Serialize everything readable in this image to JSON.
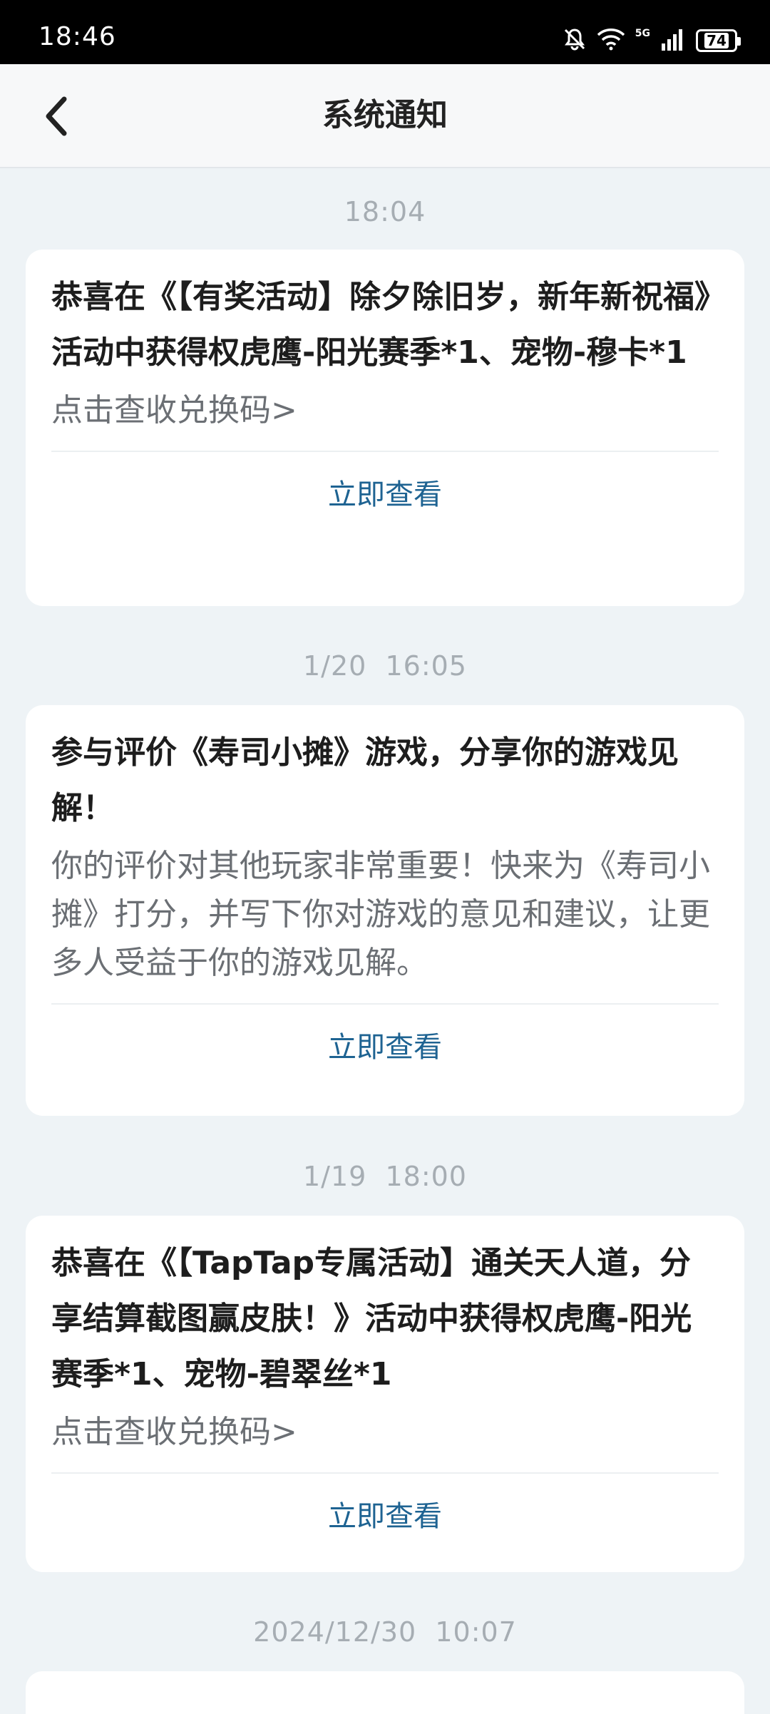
{
  "status_bar": {
    "time": "18:46",
    "network": "5G",
    "battery": "74"
  },
  "header": {
    "title": "系统通知"
  },
  "notifications": [
    {
      "timestamp": "18:04",
      "title": "恭喜在《【有奖活动】除夕除旧岁，新年新祝福》活动中获得权虎鹰-阳光赛季*1、宠物-穆卡*1",
      "body": "点击查收兑换码>",
      "action": "立即查看"
    },
    {
      "timestamp": "1/20  16:05",
      "title": "参与评价《寿司小摊》游戏，分享你的游戏见解！",
      "body": "你的评价对其他玩家非常重要！快来为《寿司小摊》打分，并写下你对游戏的意见和建议，让更多人受益于你的游戏见解。",
      "action": "立即查看"
    },
    {
      "timestamp": "1/19  18:00",
      "title": "恭喜在《【TapTap专属活动】通关天人道，分享结算截图赢皮肤！》活动中获得权虎鹰-阳光赛季*1、宠物-碧翠丝*1",
      "body": "点击查收兑换码>",
      "action": "立即查看"
    },
    {
      "timestamp": "2024/12/30  10:07"
    }
  ],
  "colors": {
    "background": "#eef3f6",
    "card": "#ffffff",
    "action_link": "#1e6392",
    "timestamp": "#a6adb3"
  }
}
